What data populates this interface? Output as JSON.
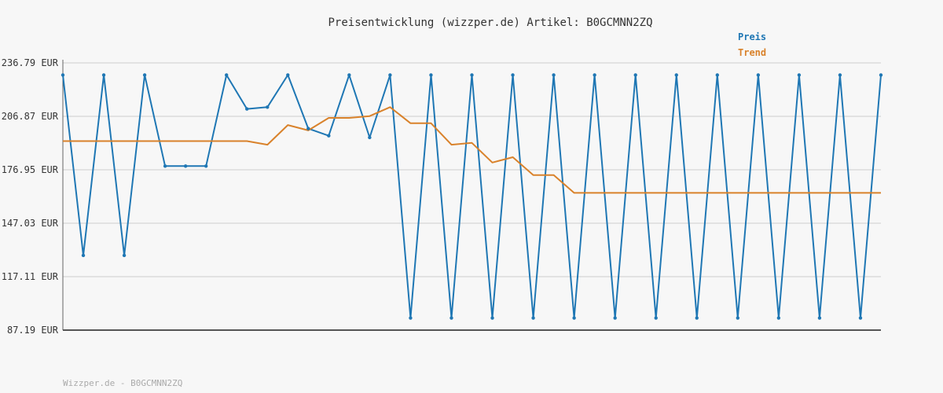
{
  "chart_data": {
    "type": "line",
    "title": "Preisentwicklung (wizzper.de) Artikel: B0GCMNN2ZQ",
    "ylim": [
      87.19,
      236.79
    ],
    "yticks": [
      "236.79 EUR",
      "206.87 EUR",
      "176.95 EUR",
      "147.03 EUR",
      "117.11 EUR",
      "87.19 EUR"
    ],
    "ytick_values": [
      236.79,
      206.87,
      176.95,
      147.03,
      117.11,
      87.19
    ],
    "grid": true,
    "legend_position": "top-right",
    "x": [
      0,
      1,
      2,
      3,
      4,
      5,
      6,
      7,
      8,
      9,
      10,
      11,
      12,
      13,
      14,
      15,
      16,
      17,
      18,
      19,
      20,
      21,
      22,
      23,
      24,
      25,
      26,
      27,
      28,
      29,
      30,
      31,
      32,
      33,
      34,
      35,
      36,
      37,
      38,
      39,
      40
    ],
    "series": [
      {
        "name": "Preis",
        "color": "#1f77b4",
        "values": [
          230,
          129,
          230,
          129,
          230,
          179,
          179,
          179,
          230,
          211,
          212,
          230,
          200,
          196,
          230,
          195,
          230,
          94,
          230,
          94,
          230,
          94,
          230,
          94,
          230,
          94,
          230,
          94,
          230,
          94,
          230,
          94,
          230,
          94,
          230,
          94,
          230,
          94,
          230,
          94,
          230
        ]
      },
      {
        "name": "Trend",
        "color": "#d9822b",
        "values": [
          193,
          193,
          193,
          193,
          193,
          193,
          193,
          193,
          193,
          193,
          191,
          202,
          199,
          206,
          206,
          207,
          212,
          203,
          203,
          191,
          192,
          181,
          184,
          174,
          174,
          164,
          164,
          164,
          164,
          164,
          164,
          164,
          164,
          164,
          164,
          164,
          164,
          164,
          164,
          164,
          164
        ]
      }
    ],
    "footer": "Wizzper.de - B0GCMNN2ZQ"
  }
}
